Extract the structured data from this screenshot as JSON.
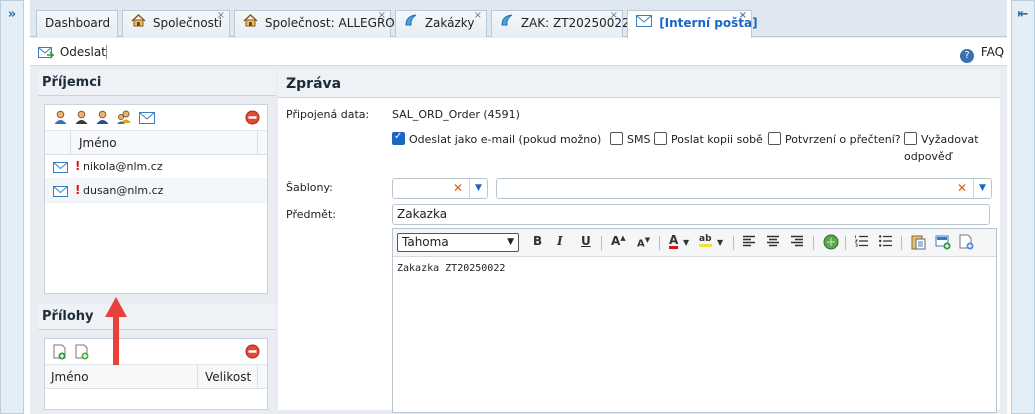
{
  "rails": {
    "left_arrow": "»",
    "right_arrow": "⇤"
  },
  "tabs": [
    {
      "label": "Dashboard",
      "icon": "none",
      "closable": false
    },
    {
      "label": "Společnosti",
      "icon": "house-icon",
      "closable": true
    },
    {
      "label": "Společnost: ALLEGRO",
      "icon": "house-icon",
      "closable": true
    },
    {
      "label": "Zakázky",
      "icon": "document-icon",
      "closable": true
    },
    {
      "label": "ZAK: ZT20250022",
      "icon": "document-icon",
      "closable": true
    },
    {
      "label": "[Interní pošta]",
      "icon": "mail-icon",
      "closable": true,
      "active": true
    }
  ],
  "tab_close": "×",
  "toolbar": {
    "send_label": "Odeslat",
    "faq_label": "FAQ"
  },
  "recipients": {
    "title": "Příjemci",
    "column_name": "Jméno",
    "rows": [
      {
        "flag": "!",
        "email": "nikola@nlm.cz"
      },
      {
        "flag": "!",
        "email": "dusan@nlm.cz"
      }
    ]
  },
  "attachments": {
    "title": "Přílohy",
    "column_name": "Jméno",
    "column_size": "Velikost"
  },
  "message": {
    "title": "Zpráva",
    "attached_label": "Připojená data:",
    "attached_value": "SAL_ORD_Order (4591)",
    "checkboxes": [
      {
        "label": "Odeslat jako e-mail (pokud možno)",
        "checked": true
      },
      {
        "label": "SMS",
        "checked": false
      },
      {
        "label": "Poslat kopii sobě",
        "checked": false
      },
      {
        "label": "Potvrzení o přečtení?",
        "checked": false
      },
      {
        "label": "Vyžadovat",
        "checked": false
      }
    ],
    "checkbox_wrap": "odpověď",
    "templates_label": "Šablony:",
    "subject_label": "Předmět:",
    "subject_value": "Zakazka",
    "font_value": "Tahoma",
    "body_text": "Zakazka ZT20250022"
  },
  "colors": {
    "accent": "#1a66c4",
    "alert": "#d11111",
    "arrow": "#e8413a"
  }
}
